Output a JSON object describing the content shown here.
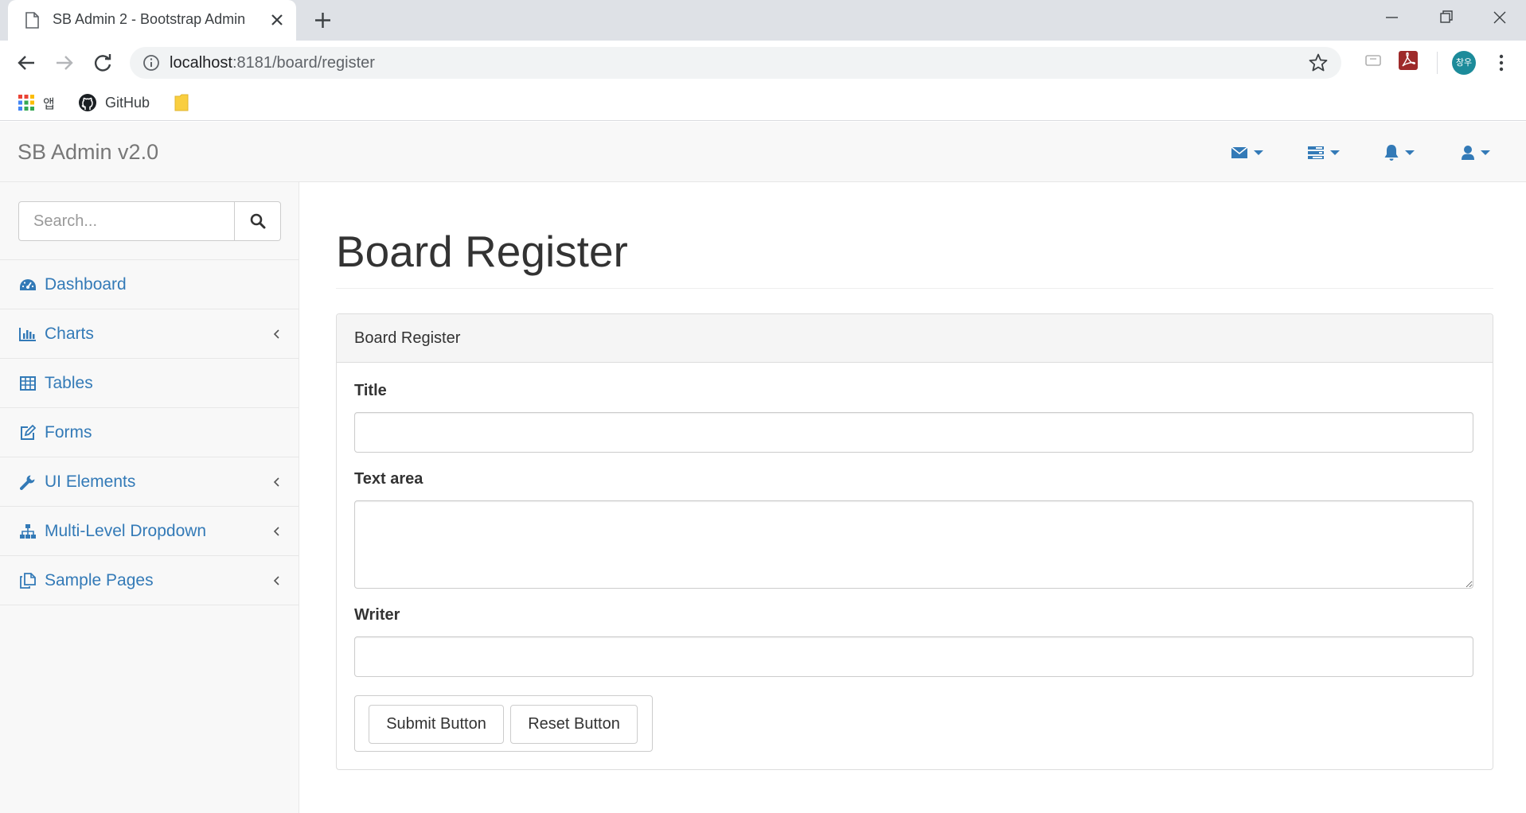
{
  "browser": {
    "tab_title": "SB Admin 2 - Bootstrap Admin",
    "url_host": "localhost",
    "url_rest": ":8181/board/register",
    "profile_initials": "창우",
    "bookmarks": [
      "앱",
      "GitHub"
    ]
  },
  "navbar": {
    "brand": "SB Admin v2.0",
    "dropdowns": [
      "envelope-icon",
      "tasks-icon",
      "bell-icon",
      "user-icon"
    ],
    "accent_color": "#337ab7"
  },
  "sidebar": {
    "search_placeholder": "Search...",
    "items": [
      {
        "label": "Dashboard",
        "icon": "dashboard-icon",
        "has_children": false
      },
      {
        "label": "Charts",
        "icon": "bar-chart-icon",
        "has_children": true
      },
      {
        "label": "Tables",
        "icon": "table-icon",
        "has_children": false
      },
      {
        "label": "Forms",
        "icon": "edit-icon",
        "has_children": false
      },
      {
        "label": "UI Elements",
        "icon": "wrench-icon",
        "has_children": true
      },
      {
        "label": "Multi-Level Dropdown",
        "icon": "sitemap-icon",
        "has_children": true
      },
      {
        "label": "Sample Pages",
        "icon": "files-icon",
        "has_children": true
      }
    ]
  },
  "main": {
    "page_title": "Board Register",
    "panel_heading": "Board Register",
    "form": {
      "title_label": "Title",
      "title_value": "",
      "textarea_label": "Text area",
      "textarea_value": "",
      "writer_label": "Writer",
      "writer_value": "",
      "submit_label": "Submit Button",
      "reset_label": "Reset Button"
    }
  }
}
